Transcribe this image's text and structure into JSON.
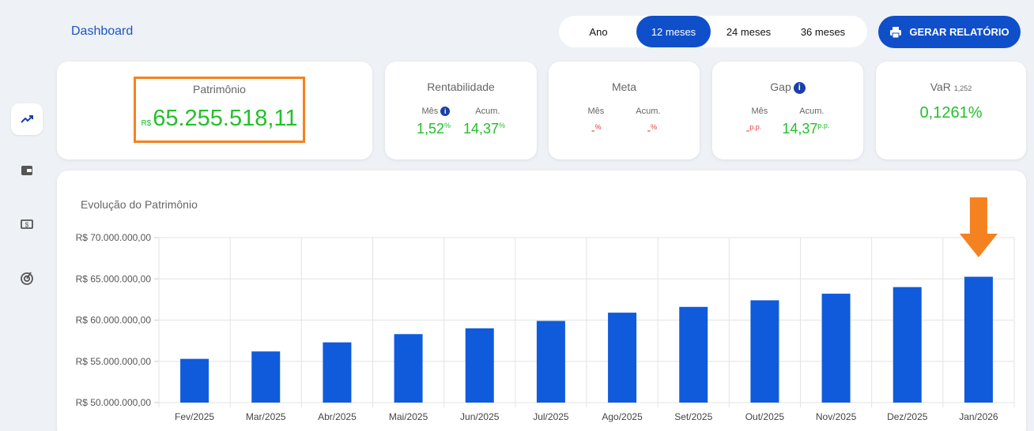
{
  "sidebar": {
    "items": [
      {
        "name": "trend-icon",
        "active": true
      },
      {
        "name": "wallet-icon",
        "active": false
      },
      {
        "name": "money-icon",
        "active": false
      },
      {
        "name": "target-icon",
        "active": false
      }
    ]
  },
  "header": {
    "title": "Dashboard",
    "periods": [
      "Ano",
      "12 meses",
      "24 meses",
      "36 meses"
    ],
    "active_period": "12 meses",
    "report_button": "GERAR RELATÓRIO"
  },
  "cards": {
    "patrimonio": {
      "title": "Patrimônio",
      "currency": "R$",
      "value": "65.255.518,11"
    },
    "rentabilidade": {
      "title": "Rentabilidade",
      "mes_label": "Mês",
      "acum_label": "Acum.",
      "mes_value": "1,52",
      "mes_unit": "%",
      "acum_value": "14,37",
      "acum_unit": "%"
    },
    "meta": {
      "title": "Meta",
      "mes_label": "Mês",
      "acum_label": "Acum.",
      "mes_value": "-",
      "mes_unit": "%",
      "acum_value": "-",
      "acum_unit": "%"
    },
    "gap": {
      "title": "Gap",
      "mes_label": "Mês",
      "acum_label": "Acum.",
      "mes_value": "-",
      "mes_unit": "p.p.",
      "acum_value": "14,37",
      "acum_unit": "p.p."
    },
    "var": {
      "title": "VaR",
      "subscript": "1,252",
      "value": "0,1261%"
    }
  },
  "colors": {
    "accent": "#0f4fc9",
    "positive": "#22c02a",
    "negative": "#e03a3a",
    "highlight": "#f58220"
  },
  "chart_data": {
    "type": "bar",
    "title": "Evolução do Patrimônio",
    "categories": [
      "Fev/2025",
      "Mar/2025",
      "Abr/2025",
      "Mai/2025",
      "Jun/2025",
      "Jul/2025",
      "Ago/2025",
      "Set/2025",
      "Out/2025",
      "Nov/2025",
      "Dez/2025",
      "Jan/2026"
    ],
    "values": [
      55300000,
      56200000,
      57300000,
      58300000,
      59000000,
      59900000,
      60900000,
      61600000,
      62400000,
      63200000,
      64000000,
      65255518.11
    ],
    "ylim": [
      50000000,
      70000000
    ],
    "yticks": [
      50000000,
      55000000,
      60000000,
      65000000,
      70000000
    ],
    "ytick_labels": [
      "R$ 50.000.000,00",
      "R$ 55.000.000,00",
      "R$ 60.000.000,00",
      "R$ 65.000.000,00",
      "R$ 70.000.000,00"
    ],
    "bar_color": "#0f5bdb",
    "grid": true,
    "highlighted_category": "Jan/2026"
  }
}
